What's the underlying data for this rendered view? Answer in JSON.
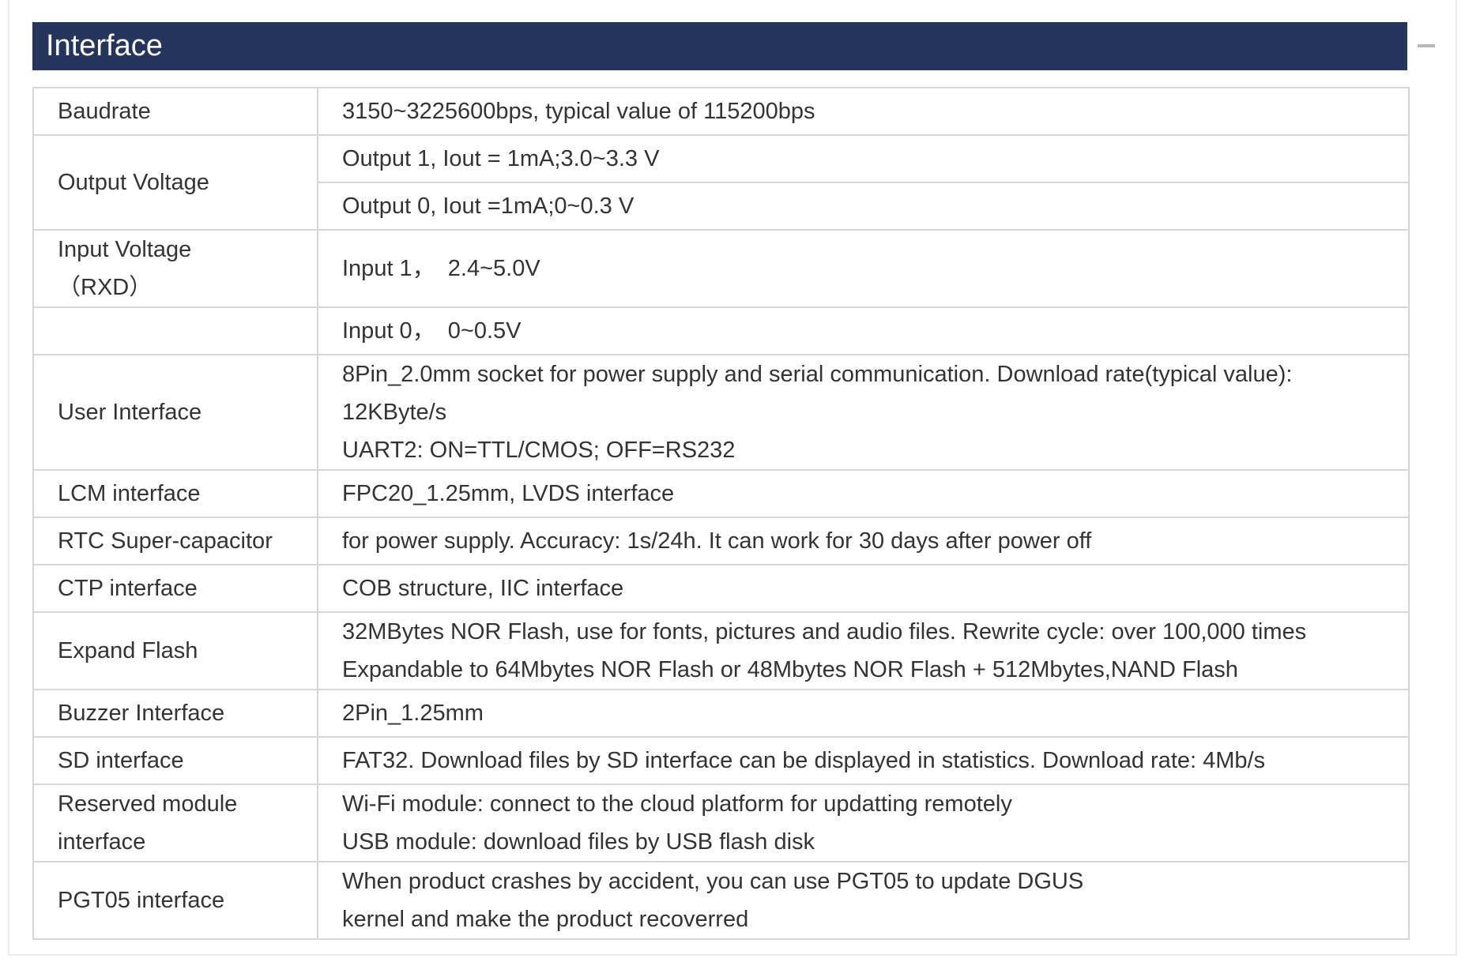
{
  "header": {
    "title": "Interface",
    "collapse_icon": "minus-icon"
  },
  "rows": [
    {
      "label": "Baudrate",
      "values": [
        "3150~3225600bps, typical value of 115200bps"
      ]
    },
    {
      "label": "Output Voltage",
      "values": [
        "Output 1, Iout = 1mA;3.0~3.3 V",
        "Output 0, Iout =1mA;0~0.3 V"
      ]
    },
    {
      "label": "Input Voltage",
      "label_sub": "（RXD）",
      "values": [
        "Input 1，  2.4~5.0V",
        "Input 0，  0~0.5V"
      ]
    },
    {
      "label": "User Interface",
      "values": [
        "8Pin_2.0mm socket for power supply and serial communication. Download rate(typical value):",
        "12KByte/s",
        "UART2: ON=TTL/CMOS; OFF=RS232"
      ]
    },
    {
      "label": "LCM interface",
      "values": [
        "FPC20_1.25mm, LVDS interface"
      ]
    },
    {
      "label": "RTC Super-capacitor",
      "values": [
        "for power supply. Accuracy: 1s/24h. It can work for 30 days after power off"
      ]
    },
    {
      "label": "CTP interface",
      "values": [
        "COB structure, IIC interface"
      ]
    },
    {
      "label": "Expand Flash",
      "values": [
        "32MBytes NOR Flash, use for fonts, pictures and audio files. Rewrite cycle: over 100,000 times",
        "Expandable to 64Mbytes NOR Flash or 48Mbytes NOR Flash + 512Mbytes,NAND Flash"
      ]
    },
    {
      "label": "Buzzer Interface",
      "values": [
        "2Pin_1.25mm"
      ]
    },
    {
      "label": "SD interface",
      "values": [
        "FAT32. Download files by SD interface can be displayed in statistics. Download rate: 4Mb/s"
      ]
    },
    {
      "label": "Reserved module",
      "label_line2": "interface",
      "values": [
        "Wi-Fi module: connect to the cloud platform for updatting remotely",
        "USB module: download files by USB flash disk"
      ]
    },
    {
      "label": "PGT05 interface",
      "values": [
        "When product crashes by accident, you can use PGT05 to update DGUS",
        "kernel and make the product recoverred"
      ]
    }
  ]
}
